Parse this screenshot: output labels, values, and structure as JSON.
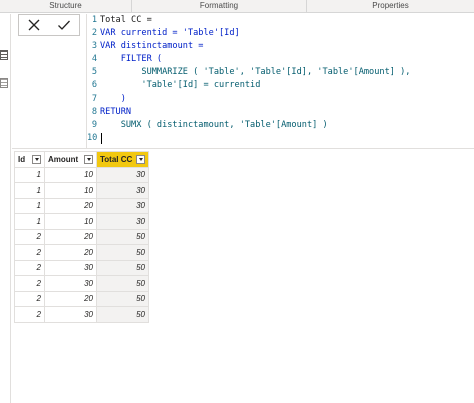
{
  "ribbon": {
    "sections": [
      "Structure",
      "Formatting",
      "Properties"
    ]
  },
  "left_rail": {
    "icons": [
      "data-view-icon",
      "model-view-icon"
    ]
  },
  "formula_bar": {
    "cancel_icon": "close-icon",
    "commit_icon": "checkmark-icon",
    "lines": [
      {
        "num": "1",
        "text": "Total CC ="
      },
      {
        "num": "2",
        "text": "VAR currentid = 'Table'[Id]"
      },
      {
        "num": "3",
        "text": "VAR distinctamount ="
      },
      {
        "num": "4",
        "text": "    FILTER ("
      },
      {
        "num": "5",
        "text": "        SUMMARIZE ( 'Table', 'Table'[Id], 'Table'[Amount] ),"
      },
      {
        "num": "6",
        "text": "        'Table'[Id] = currentid"
      },
      {
        "num": "7",
        "text": "    )"
      },
      {
        "num": "8",
        "text": "RETURN"
      },
      {
        "num": "9",
        "text": "    SUMX ( distinctamount, 'Table'[Amount] )"
      },
      {
        "num": "10",
        "text": ""
      }
    ]
  },
  "table": {
    "columns": [
      "Id",
      "Amount",
      "Total CC"
    ],
    "rows": [
      [
        "1",
        "10",
        "30"
      ],
      [
        "1",
        "10",
        "30"
      ],
      [
        "1",
        "20",
        "30"
      ],
      [
        "1",
        "10",
        "30"
      ],
      [
        "2",
        "20",
        "50"
      ],
      [
        "2",
        "20",
        "50"
      ],
      [
        "2",
        "30",
        "50"
      ],
      [
        "2",
        "30",
        "50"
      ],
      [
        "2",
        "20",
        "50"
      ],
      [
        "2",
        "30",
        "50"
      ]
    ],
    "active_column_color": "#f2c80f"
  }
}
